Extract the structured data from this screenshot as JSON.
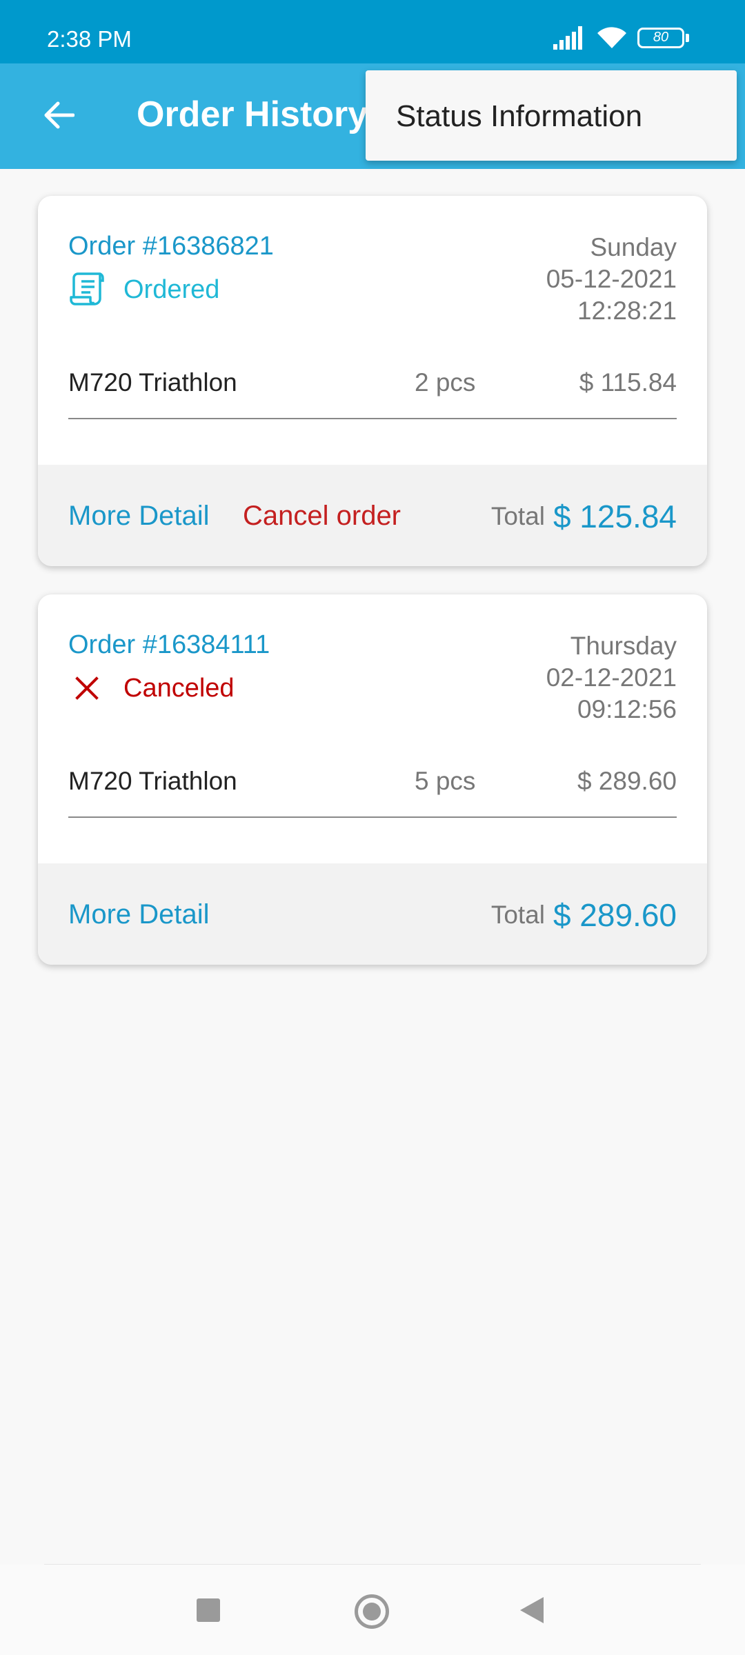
{
  "status_bar": {
    "time": "2:38 PM",
    "battery": "80",
    "icons": [
      "signal-icon",
      "wifi-icon",
      "battery-icon"
    ]
  },
  "app_bar": {
    "title": "Order History",
    "back_icon": "arrow-left-icon"
  },
  "popup_menu": {
    "items": [
      {
        "label": "Status Information"
      }
    ]
  },
  "orders": [
    {
      "number": "Order #16386821",
      "status": "Ordered",
      "status_icon": "receipt-scroll-icon",
      "day": "Sunday",
      "date": "05-12-2021",
      "time": "12:28:21",
      "item": {
        "name": "M720 Triathlon",
        "qty": "2 pcs",
        "price": "$ 115.84"
      },
      "more_detail": "More Detail",
      "cancel": "Cancel order",
      "total_label": "Total",
      "total": "$ 125.84"
    },
    {
      "number": "Order #16384111",
      "status": "Canceled",
      "status_icon": "close-x-icon",
      "day": "Thursday",
      "date": "02-12-2021",
      "time": "09:12:56",
      "item": {
        "name": "M720 Triathlon",
        "qty": "5 pcs",
        "price": "$ 289.60"
      },
      "more_detail": "More Detail",
      "total_label": "Total",
      "total": "$ 289.60"
    }
  ],
  "colors": {
    "status_bar": "#0099cc",
    "app_bar": "#33b2e0",
    "link_blue": "#1a97c9",
    "ordered_cyan": "#1fb8d6",
    "cancel_red": "#c42020"
  },
  "nav_bar": {
    "icons": [
      "recents-square-icon",
      "home-circle-icon",
      "back-triangle-icon"
    ]
  }
}
